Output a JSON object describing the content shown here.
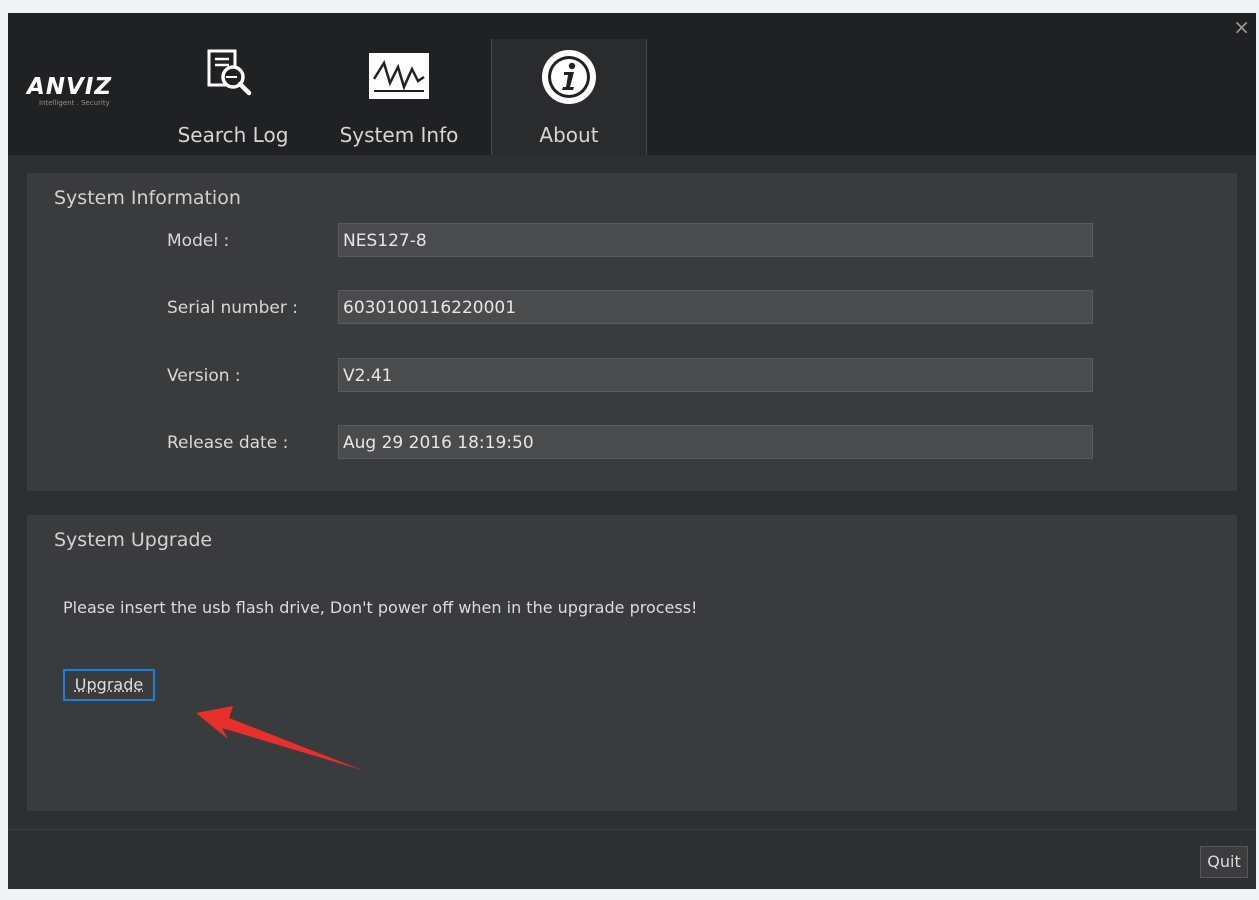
{
  "window": {
    "close_glyph": "×"
  },
  "logo": {
    "text": "ANVIZ",
    "tagline": "Intelligent . Security"
  },
  "tabs": [
    {
      "label": "Search Log",
      "icon": "search-log-icon"
    },
    {
      "label": "System Info",
      "icon": "system-info-icon"
    },
    {
      "label": "About",
      "icon": "info-icon",
      "active": true
    }
  ],
  "system_information": {
    "title": "System Information",
    "fields": [
      {
        "label": "Model :",
        "value": "NES127-8"
      },
      {
        "label": "Serial number :",
        "value": "6030100116220001"
      },
      {
        "label": "Version :",
        "value": "V2.41"
      },
      {
        "label": "Release date :",
        "value": "Aug 29 2016 18:19:50"
      }
    ]
  },
  "system_upgrade": {
    "title": "System Upgrade",
    "notice": "Please insert the usb flash drive, Don't power off when in the upgrade process!",
    "button_label": "Upgrade"
  },
  "footer": {
    "quit_label": "Quit"
  },
  "colors": {
    "accent": "#1f7fd6",
    "arrow": "#e8302a",
    "header_bg": "#202123",
    "panel_bg": "#3a3b3d"
  }
}
